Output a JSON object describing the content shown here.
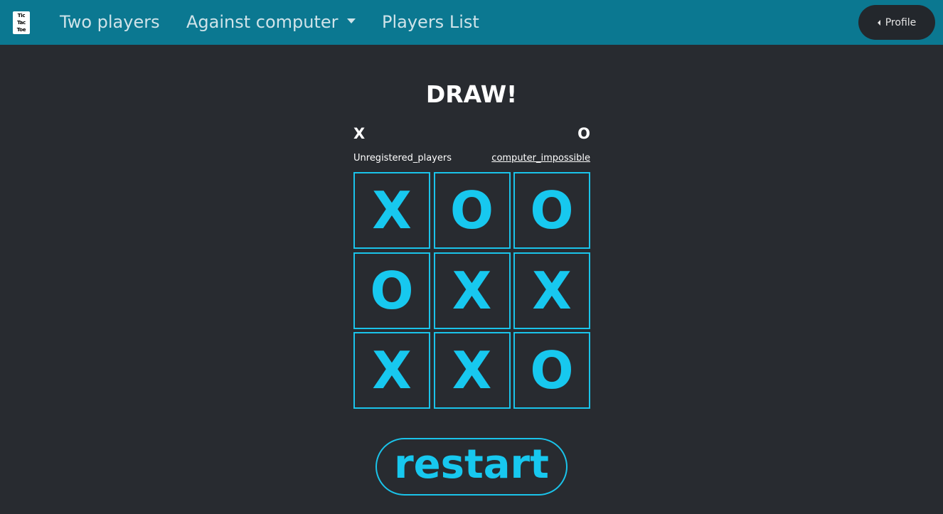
{
  "navbar": {
    "logo": [
      "Tic",
      "Tac",
      "Toe"
    ],
    "links": {
      "two_players": "Two players",
      "against_computer": "Against computer",
      "players_list": "Players List"
    },
    "profile": "Profile"
  },
  "game": {
    "result": "DRAW!",
    "player_x": {
      "mark": "X",
      "name": "Unregistered_players"
    },
    "player_o": {
      "mark": "O",
      "name": "computer_impossible"
    },
    "board": [
      [
        "X",
        "O",
        "O"
      ],
      [
        "O",
        "X",
        "X"
      ],
      [
        "X",
        "X",
        "O"
      ]
    ],
    "restart": "restart"
  },
  "colors": {
    "navbar": "#0b7891",
    "background": "#282b30",
    "accent": "#17c8ef",
    "profile_button": "#23272c"
  }
}
